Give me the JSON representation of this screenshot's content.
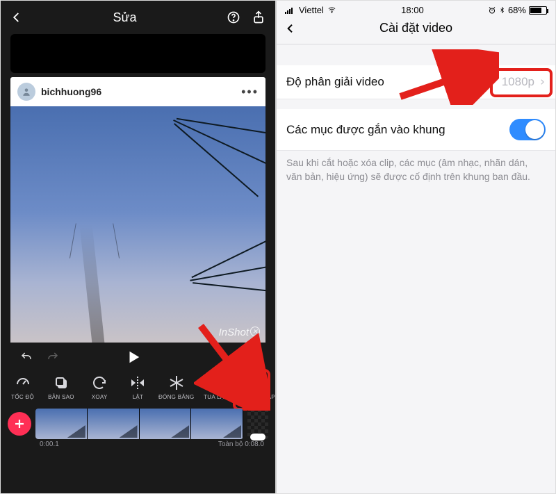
{
  "left": {
    "title": "Sửa",
    "post": {
      "username": "bichhuong96"
    },
    "watermark": "InShot",
    "tools": [
      {
        "id": "speed",
        "label": "TỐC ĐỘ"
      },
      {
        "id": "copy",
        "label": "BẢN SAO"
      },
      {
        "id": "rotate",
        "label": "XOAY"
      },
      {
        "id": "flip",
        "label": "LẬT"
      },
      {
        "id": "freeze",
        "label": "ĐÓNG BĂNG"
      },
      {
        "id": "rewind",
        "label": "TUA LẠI"
      },
      {
        "id": "settings",
        "label": "CÁC THIẾT LẬP"
      }
    ],
    "timeline": {
      "start": "0:00.1",
      "total_label": "Toàn bộ",
      "total": "0:08.0"
    }
  },
  "right": {
    "status": {
      "carrier": "Viettel",
      "time": "18:00",
      "battery": "68%"
    },
    "title": "Cài đặt video",
    "rows": {
      "resolution": {
        "label": "Độ phân giải video",
        "value": "1080p"
      },
      "snap": {
        "label": "Các mục được gắn vào khung",
        "desc": "Sau khi cắt hoặc xóa clip, các mục (âm nhạc, nhãn dán, văn bản, hiệu ứng) sẽ được cố định trên khung ban đầu."
      }
    }
  }
}
